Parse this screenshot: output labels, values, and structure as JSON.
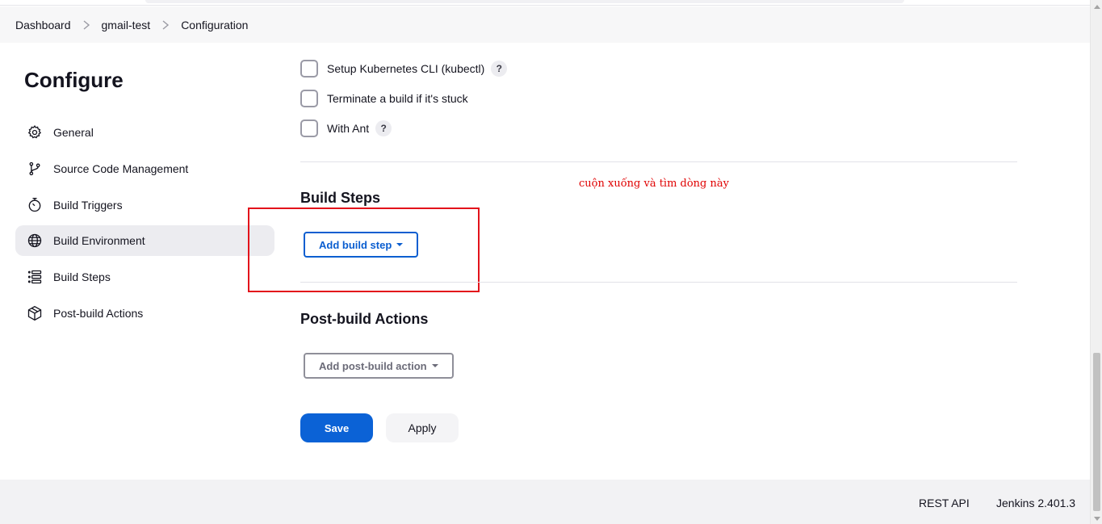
{
  "breadcrumb": {
    "items": [
      "Dashboard",
      "gmail-test",
      "Configuration"
    ]
  },
  "side": {
    "title": "Configure",
    "items": [
      {
        "label": "General",
        "icon": "gear-icon"
      },
      {
        "label": "Source Code Management",
        "icon": "branch-icon"
      },
      {
        "label": "Build Triggers",
        "icon": "timer-icon"
      },
      {
        "label": "Build Environment",
        "icon": "globe-icon",
        "active": true
      },
      {
        "label": "Build Steps",
        "icon": "list-icon"
      },
      {
        "label": "Post-build Actions",
        "icon": "package-icon"
      }
    ]
  },
  "build_env": {
    "options": [
      {
        "label": "Setup Kubernetes CLI (kubectl)",
        "help": "?",
        "checked": false
      },
      {
        "label": "Terminate a build if it's stuck",
        "checked": false
      },
      {
        "label": "With Ant",
        "help": "?",
        "checked": false
      }
    ]
  },
  "annotation": "cuộn xuống và tìm dòng này",
  "build_steps": {
    "title": "Build Steps",
    "add_button": "Add build step"
  },
  "post_build": {
    "title": "Post-build Actions",
    "add_button": "Add post-build action"
  },
  "actions": {
    "save": "Save",
    "apply": "Apply"
  },
  "footer": {
    "rest_api": "REST API",
    "version": "Jenkins 2.401.3"
  },
  "colors": {
    "accent": "#0b62d6",
    "annotation": "#e3131b"
  }
}
